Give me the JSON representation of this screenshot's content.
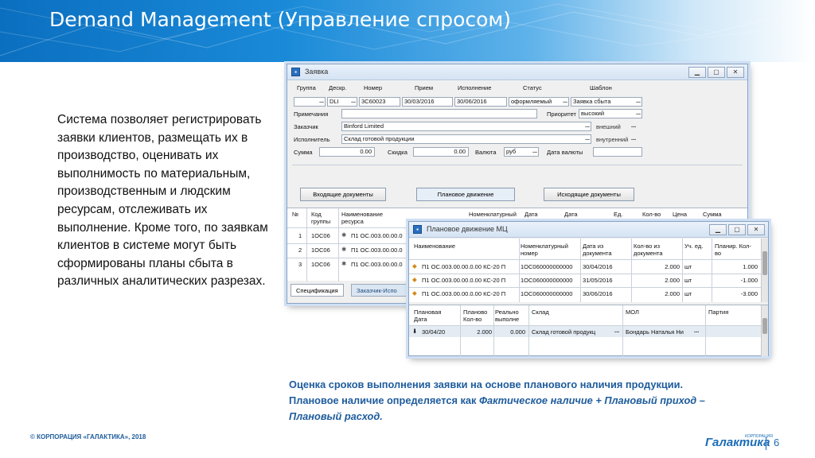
{
  "header": {
    "title": "Demand Management (Управление спросом)"
  },
  "description": "Система позволяет регистрировать заявки клиентов, размещать их в производство, оценивать их выполнимость по материальным, производственным и людским ресурсам, отслеживать их выполнение. Кроме того, по заявкам клиентов в системе могут быть сформированы планы сбыта в различных аналитических разрезах.",
  "caption": {
    "line1": "Оценка сроков выполнения заявки на основе планового наличия продукции.",
    "line2_prefix": "Плановое наличие определяется как ",
    "line2_italic": "Фактическое наличие + Плановый приход –",
    "line3_italic": "Плановый расход."
  },
  "footer": {
    "copyright": "© КОРПОРАЦИЯ «ГАЛАКТИКА», 2018",
    "logo": "Галактика",
    "logo_sub": "КОРПОРАЦИЯ",
    "page": "6"
  },
  "order_window": {
    "title": "Заявка",
    "labels": {
      "group": "Группа",
      "descr": "Дескр.",
      "number": "Номер",
      "receipt": "Прием",
      "execution": "Исполнение",
      "status": "Статус",
      "template": "Шаблон",
      "notes": "Примечания",
      "priority": "Приоритет",
      "customer": "Заказчик",
      "executor": "Исполнитель",
      "sum": "Сумма",
      "discount": "Скидка",
      "currency": "Валюта",
      "currency_date": "Дата валюты"
    },
    "values": {
      "descr": "DLI",
      "number": "3С60023",
      "receipt": "30/03/2016",
      "execution": "30/06/2016",
      "status": "оформляемый",
      "template": "Заявка сбыта",
      "notes": "",
      "priority": "высокий",
      "customer": "Binford Limited",
      "customer_type": "внешний",
      "executor": "Склад готовой продукции",
      "executor_type": "внутренний",
      "sum": "0.00",
      "discount": "0.00",
      "currency": "руб"
    },
    "buttons": {
      "incoming": "Входящие документы",
      "planned": "Плановое движение",
      "outgoing": "Исходящие документы"
    },
    "grid": {
      "headers": [
        "№",
        "Код группы",
        "Наименование ресурса",
        "Номенклатурный",
        "Дата",
        "Дата",
        "Ед.",
        "Кол-во",
        "Цена",
        "Сумма"
      ],
      "rows": [
        {
          "n": "1",
          "code": "1ОС06",
          "name": "П1 ОС.003.00.00.0"
        },
        {
          "n": "2",
          "code": "1ОС06",
          "name": "П1 ОС.003.00.00.0"
        },
        {
          "n": "3",
          "code": "1ОС06",
          "name": "П1 ОС.003.00.00.0"
        }
      ]
    },
    "tabs": {
      "spec": "Спецификация",
      "customer": "Заказчик-Испо"
    }
  },
  "plan_window": {
    "title": "Плановое движение МЦ",
    "grid1": {
      "headers": [
        "Наименование",
        "Номенклатурный номер",
        "Дата из документа",
        "Кол-во из документа",
        "Уч. ед.",
        "Планир. Кол-во"
      ],
      "rows": [
        {
          "name": "П1 ОС.003.00.00.0.00 КС-20 П",
          "nomen": "1ОС060000000000",
          "date": "30/04/2016",
          "qty": "2.000",
          "unit": "шт",
          "plan": "1.000"
        },
        {
          "name": "П1 ОС.003.00.00.0.00 КС-20 П",
          "nomen": "1ОС060000000000",
          "date": "31/05/2016",
          "qty": "2.000",
          "unit": "шт",
          "plan": "-1.000"
        },
        {
          "name": "П1 ОС.003.00.00.0.00 КС-20 П",
          "nomen": "1ОС060000000000",
          "date": "30/06/2016",
          "qty": "2.000",
          "unit": "шт",
          "plan": "-3.000"
        }
      ]
    },
    "grid2": {
      "headers": [
        "Плановая Дата",
        "Планово Кол-во",
        "Реально выполне",
        "Склад",
        "МОЛ",
        "Партия"
      ],
      "rows": [
        {
          "date": "30/04/20",
          "plan": "2.000",
          "real": "0.000",
          "warehouse": "Склад готовой продукц",
          "mol": "Бондарь Наталья Ни",
          "batch": ""
        }
      ]
    }
  }
}
